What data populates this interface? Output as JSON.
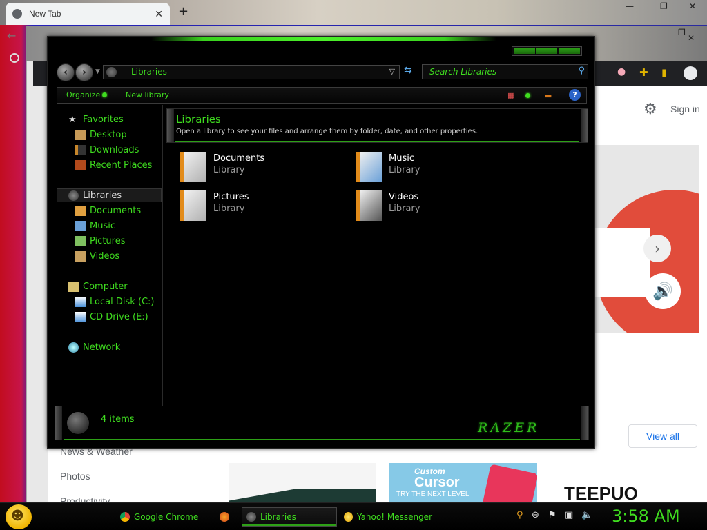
{
  "chrome": {
    "tab_title": "New Tab",
    "tab_close": "✕",
    "new_tab": "+",
    "sign_in": "Sign in",
    "view_all": "View all",
    "nav_items": [
      "News & Weather",
      "Photos",
      "Productivity"
    ],
    "thumb_custom": "Custom",
    "thumb_cursor": "Cursor",
    "thumb_sub": "TRY THE NEXT LEVEL",
    "thumb_bottom": "TEEPUO"
  },
  "explorer": {
    "address": "Libraries",
    "search_placeholder": "Search Libraries",
    "toolbar": {
      "organize": "Organize",
      "new_library": "New library",
      "help": "?"
    },
    "nav": {
      "favorites": "Favorites",
      "desktop": "Desktop",
      "downloads": "Downloads",
      "recent_places": "Recent Places",
      "libraries": "Libraries",
      "documents": "Documents",
      "music": "Music",
      "pictures": "Pictures",
      "videos": "Videos",
      "computer": "Computer",
      "local_disk": "Local Disk (C:)",
      "cd_drive": "CD Drive (E:)",
      "network": "Network"
    },
    "header": {
      "title": "Libraries",
      "description": "Open a library to see your files and arrange them by folder, date, and other properties."
    },
    "libraries": [
      {
        "name": "Documents",
        "type": "Library"
      },
      {
        "name": "Music",
        "type": "Library"
      },
      {
        "name": "Pictures",
        "type": "Library"
      },
      {
        "name": "Videos",
        "type": "Library"
      }
    ],
    "status": {
      "count": "4 items",
      "logo": "RAZER"
    }
  },
  "taskbar": {
    "items": [
      "Google Chrome",
      "Libraries",
      "Yahoo! Messenger"
    ],
    "clock": "3:58 AM"
  },
  "colors": {
    "accent": "#3fdc1f",
    "window_bg": "#000000"
  }
}
